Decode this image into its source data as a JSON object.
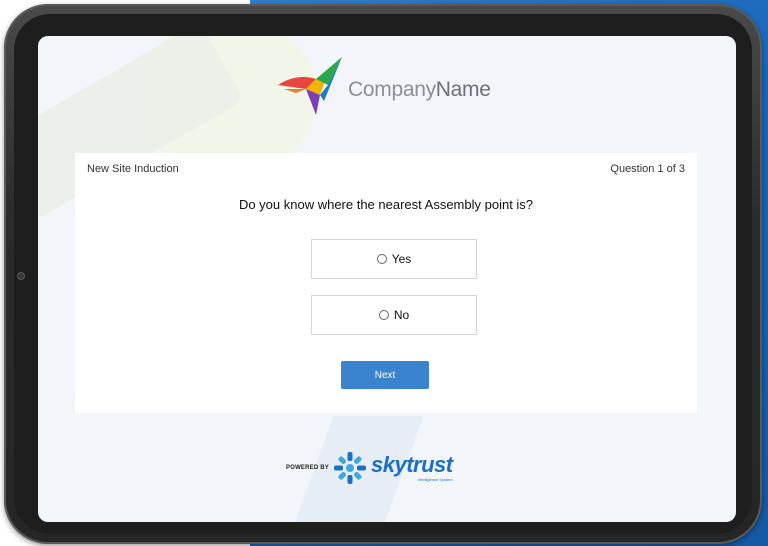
{
  "brand": {
    "company_name_light": "Company",
    "company_name_bold": "Name"
  },
  "form": {
    "title": "New Site Induction",
    "progress": "Question 1 of 3",
    "question": "Do you know where the nearest Assembly point is?",
    "options": [
      {
        "label": "Yes",
        "selected": false
      },
      {
        "label": "No",
        "selected": false
      }
    ],
    "next_label": "Next"
  },
  "footer": {
    "powered_by": "POWERED BY",
    "product_name": "skytrust",
    "product_tagline": "Intelligence System"
  },
  "colors": {
    "accent": "#3a83cf",
    "backdrop": "#1a67b8",
    "brand_blue": "#1e6fc4"
  },
  "icons": [
    "company-logo-icon",
    "radio-icon",
    "skytrust-logo-icon"
  ]
}
